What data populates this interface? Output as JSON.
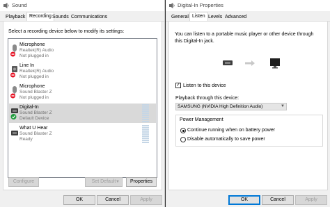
{
  "sound": {
    "title": "Sound",
    "tabs": [
      "Playback",
      "Recording",
      "Sounds",
      "Communications"
    ],
    "active_tab": 1,
    "instruction": "Select a recording device below to modify its settings:",
    "devices": [
      {
        "name": "Microphone",
        "driver": "Realtek(R) Audio",
        "status": "Not plugged in",
        "icon": "microphone-unplugged-icon",
        "selected": false
      },
      {
        "name": "Line In",
        "driver": "Realtek(R) Audio",
        "status": "Not plugged in",
        "icon": "line-in-unplugged-icon",
        "selected": false
      },
      {
        "name": "Microphone",
        "driver": "Sound Blaster Z",
        "status": "Not plugged in",
        "icon": "microphone-unplugged-icon",
        "selected": false
      },
      {
        "name": "Digital-In",
        "driver": "Sound Blaster Z",
        "status": "Default Device",
        "icon": "digital-in-default-icon",
        "selected": true
      },
      {
        "name": "What U Hear",
        "driver": "Sound Blaster Z",
        "status": "Ready",
        "icon": "what-u-hear-icon",
        "selected": false
      }
    ],
    "buttons": {
      "configure": "Configure",
      "set_default": "Set Default",
      "properties": "Properties",
      "ok": "OK",
      "cancel": "Cancel",
      "apply": "Apply"
    }
  },
  "props": {
    "title": "Digital-In Properties",
    "tabs": [
      "General",
      "Listen",
      "Levels",
      "Advanced"
    ],
    "active_tab": 1,
    "description": "You can listen to a portable music player or other device through this Digital-In jack.",
    "listen_label": "Listen to this device",
    "listen_checked": true,
    "playback_label": "Playback through this device:",
    "playback_value": "SAMSUNG (NVIDIA High Definition Audio)",
    "power_title": "Power Management",
    "power_options": [
      "Continue running when on battery power",
      "Disable automatically to save power"
    ],
    "power_selected": 0,
    "buttons": {
      "ok": "OK",
      "cancel": "Cancel",
      "apply": "Apply"
    }
  },
  "colors": {
    "accent": "#0078d7",
    "selected_row": "#d9d9d9",
    "unplugged": "#e81123",
    "default_check": "#1e9b3c"
  }
}
